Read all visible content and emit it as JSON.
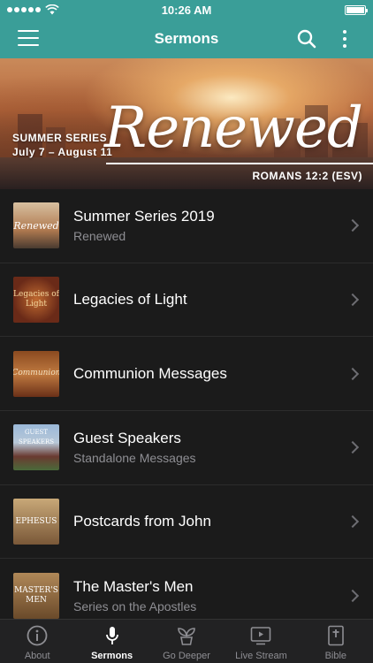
{
  "status_bar": {
    "time": "10:26 AM"
  },
  "header": {
    "title": "Sermons"
  },
  "banner": {
    "series_label": "SUMMER SERIES",
    "dates": "July 7 – August 11",
    "title": "Renewed",
    "reference": "ROMANS 12:2 (ESV)"
  },
  "sermons": [
    {
      "title": "Summer Series 2019",
      "subtitle": "Renewed",
      "thumb_text": "Renewed"
    },
    {
      "title": "Legacies of Light",
      "subtitle": "",
      "thumb_text": "Legacies of Light"
    },
    {
      "title": "Communion Messages",
      "subtitle": "",
      "thumb_text": "Communion"
    },
    {
      "title": "Guest Speakers",
      "subtitle": "Standalone Messages",
      "thumb_text": "GUEST SPEAKERS"
    },
    {
      "title": "Postcards from John",
      "subtitle": "",
      "thumb_text": "EPHESUS"
    },
    {
      "title": "The Master's Men",
      "subtitle": "Series on the Apostles",
      "thumb_text": "MASTER'S MEN"
    }
  ],
  "tabs": [
    {
      "label": "About",
      "icon": "info-icon"
    },
    {
      "label": "Sermons",
      "icon": "microphone-icon"
    },
    {
      "label": "Go Deeper",
      "icon": "sprout-icon"
    },
    {
      "label": "Live Stream",
      "icon": "play-screen-icon"
    },
    {
      "label": "Bible",
      "icon": "bible-icon"
    }
  ],
  "colors": {
    "accent": "#3a9e98",
    "background": "#1b1b1b",
    "tab_bar": "#222223",
    "subtitle": "#8e8e93"
  }
}
